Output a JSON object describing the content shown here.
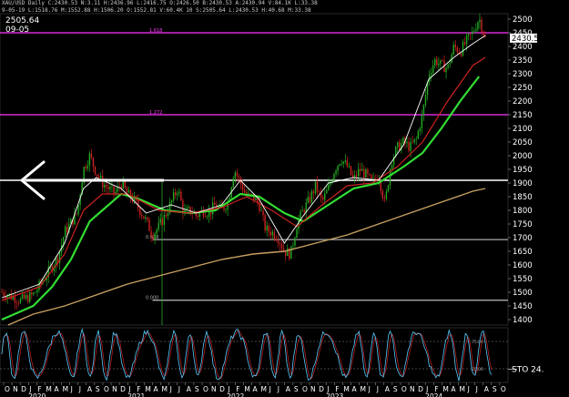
{
  "header": {
    "title_line": "XAU/USD  Daily  C:2430.53  N:3.11  H:2436.96  L:2416.75  O:2426.50  B:2430.53  A:2430.94  V:84.1K  L:33.38",
    "indicator_line": "9-05-19  L:1518.76  M:1552.88  H:1506.20  O:1552.81  V:60.4K  10  S:2505.64  L:2430.53  H:40.68  M:33.38"
  },
  "top_left": {
    "price": "2505.64",
    "date": "09-05"
  },
  "colors": {
    "background": "#000000",
    "grid": "#1c1c1c",
    "magenta_level": "#ff33ff",
    "support_line": "#ffffff",
    "ma_green": "#33dd33",
    "ma_tan": "#c8a060",
    "ma_red": "#cc2222",
    "ma_white": "#ffffff",
    "ma_blue": "#8899ff",
    "candle_up": "#22aa22",
    "candle_down": "#cc2222",
    "stoch_k": "#55ccff",
    "stoch_d": "#cc2222",
    "arrow": "#ffffff"
  },
  "chart_data": {
    "type": "candlestick",
    "symbol": "XAU/USD",
    "timeframe": "Daily",
    "ylim": [
      1380,
      2520
    ],
    "yticks": [
      1400,
      1450,
      1500,
      1550,
      1600,
      1650,
      1700,
      1750,
      1800,
      1850,
      1900,
      1950,
      2000,
      2050,
      2100,
      2150,
      2200,
      2250,
      2300,
      2350,
      2400,
      2450,
      2500
    ],
    "last_price": "2430.53",
    "x_month_labels": [
      "O",
      "N",
      "D",
      "J",
      "F",
      "M",
      "A",
      "M",
      "J",
      "J",
      "A",
      "S",
      "O",
      "N",
      "D",
      "J",
      "F",
      "M",
      "A",
      "M",
      "J",
      "J",
      "A",
      "S",
      "O",
      "N",
      "D",
      "J",
      "F",
      "M",
      "A",
      "M",
      "J",
      "J",
      "A",
      "S",
      "O",
      "N",
      "D",
      "J",
      "F",
      "M",
      "A",
      "M",
      "J",
      "J",
      "A",
      "S",
      "O",
      "N",
      "D",
      "J",
      "F",
      "M",
      "A",
      "M",
      "J",
      "J",
      "A",
      "S",
      "O"
    ],
    "x_year_labels": [
      "2020",
      "2021",
      "2022",
      "2023",
      "2024"
    ],
    "levels": [
      {
        "label": "1.618",
        "value": 2450,
        "color": "#ff33ff",
        "x_start_frac": 0
      },
      {
        "label": "1.272",
        "value": 2150,
        "color": "#ff33ff",
        "x_start_frac": 0
      },
      {
        "label": "",
        "value": 1910,
        "color": "#ffffff",
        "x_start_frac": 0
      },
      {
        "label": "0.618",
        "value": 1693,
        "color": "#aaaaaa",
        "x_start_frac": 0.3
      },
      {
        "label": "0.000",
        "value": 1471,
        "color": "#aaaaaa",
        "x_start_frac": 0.3
      }
    ],
    "price_path": [
      [
        0,
        1500
      ],
      [
        3,
        1470
      ],
      [
        5,
        1490
      ],
      [
        7,
        1560
      ],
      [
        9,
        1630
      ],
      [
        10,
        1720
      ],
      [
        12,
        1790
      ],
      [
        13,
        1950
      ],
      [
        14,
        2000
      ],
      [
        15,
        1940
      ],
      [
        16,
        1900
      ],
      [
        17,
        1880
      ],
      [
        18,
        1860
      ],
      [
        19,
        1900
      ],
      [
        20,
        1860
      ],
      [
        21,
        1840
      ],
      [
        22,
        1800
      ],
      [
        23,
        1760
      ],
      [
        24,
        1710
      ],
      [
        25,
        1740
      ],
      [
        26,
        1780
      ],
      [
        27,
        1830
      ],
      [
        28,
        1880
      ],
      [
        29,
        1790
      ],
      [
        30,
        1800
      ],
      [
        31,
        1780
      ],
      [
        32,
        1800
      ],
      [
        33,
        1790
      ],
      [
        34,
        1820
      ],
      [
        35,
        1800
      ],
      [
        36,
        1830
      ],
      [
        37,
        1950
      ],
      [
        38,
        1900
      ],
      [
        39,
        1850
      ],
      [
        40,
        1850
      ],
      [
        41,
        1820
      ],
      [
        42,
        1730
      ],
      [
        43,
        1720
      ],
      [
        44,
        1700
      ],
      [
        45,
        1650
      ],
      [
        46,
        1640
      ],
      [
        47,
        1750
      ],
      [
        48,
        1800
      ],
      [
        49,
        1840
      ],
      [
        50,
        1890
      ],
      [
        51,
        1830
      ],
      [
        52,
        1880
      ],
      [
        53,
        1950
      ],
      [
        54,
        1990
      ],
      [
        55,
        1960
      ],
      [
        56,
        1910
      ],
      [
        57,
        1950
      ],
      [
        58,
        1930
      ],
      [
        59,
        1900
      ],
      [
        60,
        1930
      ],
      [
        61,
        1820
      ],
      [
        62,
        1980
      ],
      [
        63,
        2030
      ],
      [
        64,
        2050
      ],
      [
        65,
        2030
      ],
      [
        66,
        2060
      ],
      [
        67,
        2150
      ],
      [
        68,
        2300
      ],
      [
        69,
        2350
      ],
      [
        70,
        2330
      ],
      [
        71,
        2320
      ],
      [
        72,
        2400
      ],
      [
        73,
        2380
      ],
      [
        74,
        2420
      ],
      [
        75,
        2450
      ],
      [
        76,
        2505
      ],
      [
        77,
        2430
      ]
    ],
    "ma_series": [
      {
        "key": "ma_green",
        "points": [
          [
            0,
            1400
          ],
          [
            5,
            1450
          ],
          [
            8,
            1520
          ],
          [
            11,
            1620
          ],
          [
            14,
            1760
          ],
          [
            16,
            1800
          ],
          [
            19,
            1860
          ],
          [
            22,
            1840
          ],
          [
            26,
            1800
          ],
          [
            30,
            1790
          ],
          [
            34,
            1800
          ],
          [
            38,
            1860
          ],
          [
            41,
            1850
          ],
          [
            45,
            1790
          ],
          [
            48,
            1760
          ],
          [
            52,
            1820
          ],
          [
            56,
            1880
          ],
          [
            60,
            1900
          ],
          [
            64,
            1960
          ],
          [
            67,
            2010
          ],
          [
            70,
            2100
          ],
          [
            73,
            2200
          ],
          [
            76,
            2290
          ]
        ]
      },
      {
        "key": "ma_red",
        "points": [
          [
            0,
            1470
          ],
          [
            6,
            1520
          ],
          [
            10,
            1640
          ],
          [
            13,
            1800
          ],
          [
            16,
            1860
          ],
          [
            20,
            1860
          ],
          [
            25,
            1800
          ],
          [
            30,
            1790
          ],
          [
            35,
            1810
          ],
          [
            39,
            1850
          ],
          [
            43,
            1800
          ],
          [
            47,
            1740
          ],
          [
            51,
            1820
          ],
          [
            55,
            1890
          ],
          [
            59,
            1900
          ],
          [
            63,
            1960
          ],
          [
            67,
            2050
          ],
          [
            71,
            2200
          ],
          [
            75,
            2330
          ],
          [
            77,
            2360
          ]
        ]
      },
      {
        "key": "ma_tan",
        "points": [
          [
            1,
            1380
          ],
          [
            5,
            1420
          ],
          [
            10,
            1450
          ],
          [
            15,
            1490
          ],
          [
            20,
            1530
          ],
          [
            25,
            1560
          ],
          [
            30,
            1590
          ],
          [
            35,
            1620
          ],
          [
            40,
            1640
          ],
          [
            45,
            1650
          ],
          [
            50,
            1680
          ],
          [
            55,
            1710
          ],
          [
            60,
            1750
          ],
          [
            65,
            1790
          ],
          [
            70,
            1830
          ],
          [
            75,
            1870
          ],
          [
            77,
            1880
          ]
        ]
      },
      {
        "key": "ma_white",
        "points": [
          [
            0,
            1480
          ],
          [
            6,
            1530
          ],
          [
            10,
            1680
          ],
          [
            13,
            1880
          ],
          [
            15,
            1920
          ],
          [
            19,
            1880
          ],
          [
            23,
            1790
          ],
          [
            27,
            1820
          ],
          [
            31,
            1790
          ],
          [
            35,
            1820
          ],
          [
            38,
            1910
          ],
          [
            41,
            1840
          ],
          [
            45,
            1680
          ],
          [
            48,
            1780
          ],
          [
            52,
            1900
          ],
          [
            56,
            1920
          ],
          [
            60,
            1910
          ],
          [
            64,
            2040
          ],
          [
            68,
            2280
          ],
          [
            72,
            2360
          ],
          [
            75,
            2410
          ],
          [
            77,
            2440
          ]
        ]
      }
    ],
    "stochastic": {
      "label": "STO 24.",
      "levels": [
        75,
        25
      ],
      "tick_labels": [
        "75.00",
        "25.00"
      ],
      "last_k": 24
    }
  },
  "annotations": {
    "arrow": "left-arrow"
  }
}
